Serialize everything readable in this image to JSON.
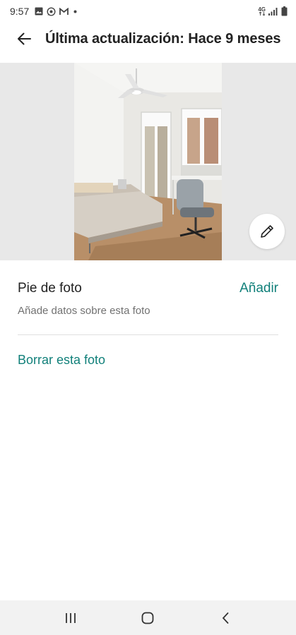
{
  "status_bar": {
    "time": "9:57",
    "left_icons": [
      "gallery-icon",
      "whatsapp-icon",
      "gmail-icon",
      "dot-icon"
    ],
    "right_icons": [
      "4g-icon",
      "signal-icon",
      "battery-icon"
    ],
    "network_label": "4G"
  },
  "app_bar": {
    "back_icon": "arrow-left-icon",
    "title": "Última actualización: Hace 9 meses"
  },
  "photo": {
    "edit_icon": "pencil-icon",
    "background_color": "#e8e8e8"
  },
  "caption": {
    "title": "Pie de foto",
    "add_label": "Añadir",
    "help_text": "Añade datos sobre esta foto"
  },
  "actions": {
    "delete_label": "Borrar esta foto"
  },
  "nav_bar": {
    "buttons": [
      "recent-apps-icon",
      "home-icon",
      "back-icon"
    ]
  },
  "colors": {
    "accent": "#11807a",
    "text_primary": "#222222",
    "text_secondary": "#717171"
  }
}
